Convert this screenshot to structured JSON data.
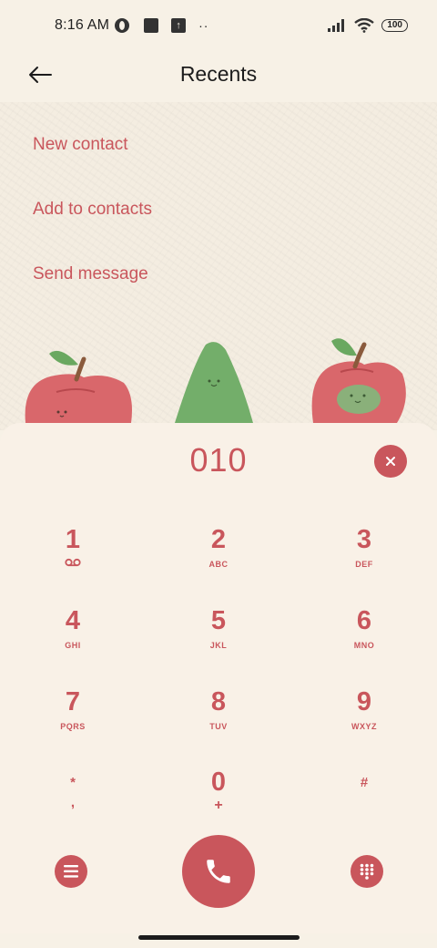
{
  "status_bar": {
    "time": "8:16 AM",
    "dots": "··",
    "battery": "100",
    "icons": [
      "vpn-icon",
      "square-icon",
      "upload-icon",
      "signal-icon",
      "wifi-icon",
      "battery-icon"
    ]
  },
  "header": {
    "title": "Recents",
    "back_icon": "arrow-left-icon"
  },
  "menu": {
    "items": [
      {
        "label": "New contact"
      },
      {
        "label": "Add to contacts"
      },
      {
        "label": "Send message"
      }
    ]
  },
  "dialer": {
    "number": "010",
    "clear_icon": "close-icon",
    "keys": [
      {
        "digit": "1",
        "letters": "voicemail-icon"
      },
      {
        "digit": "2",
        "letters": "ABC"
      },
      {
        "digit": "3",
        "letters": "DEF"
      },
      {
        "digit": "4",
        "letters": "GHI"
      },
      {
        "digit": "5",
        "letters": "JKL"
      },
      {
        "digit": "6",
        "letters": "MNO"
      },
      {
        "digit": "7",
        "letters": "PQRS"
      },
      {
        "digit": "8",
        "letters": "TUV"
      },
      {
        "digit": "9",
        "letters": "WXYZ"
      },
      {
        "digit": "*",
        "letters": ","
      },
      {
        "digit": "0",
        "letters": "+"
      },
      {
        "digit": "#",
        "letters": ""
      }
    ]
  },
  "bottom_bar": {
    "menu_icon": "menu-icon",
    "call_icon": "phone-icon",
    "keypad_icon": "dialpad-icon"
  },
  "colors": {
    "accent": "#c9565c",
    "background": "#f7f1e6",
    "paper": "#f4ede1",
    "leaf": "#6aa860"
  }
}
